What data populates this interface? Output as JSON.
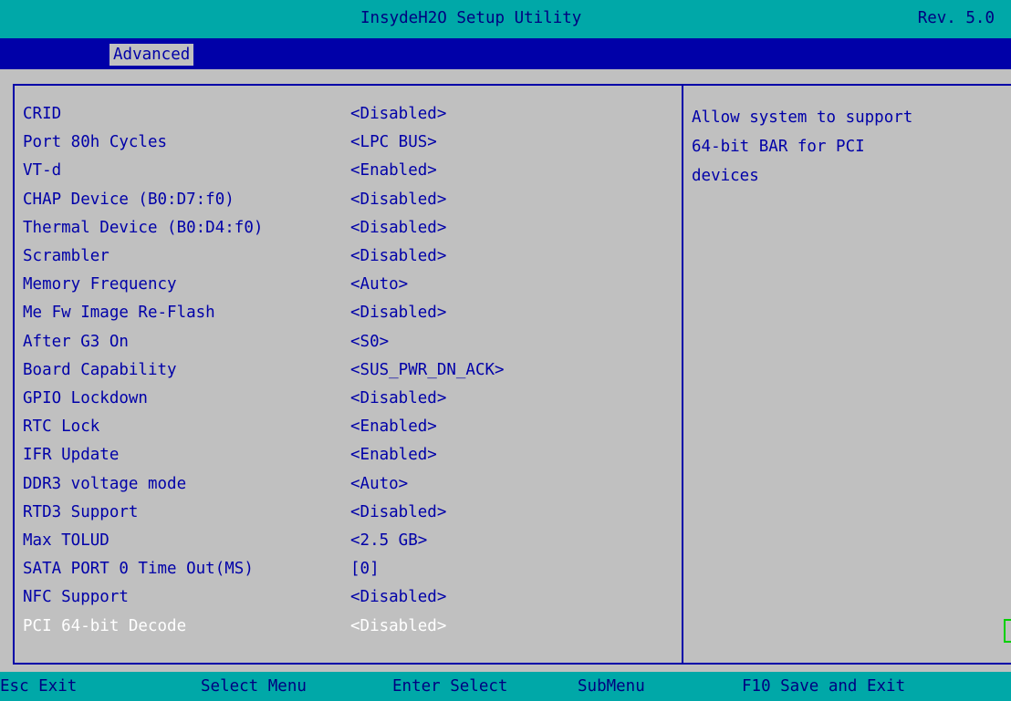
{
  "header": {
    "title": "InsydeH2O Setup Utility",
    "revision": "Rev. 5.0"
  },
  "menu": {
    "active_tab": "Advanced"
  },
  "settings": [
    {
      "label": "CRID",
      "value": "<Disabled>"
    },
    {
      "label": "Port 80h Cycles",
      "value": "<LPC BUS>"
    },
    {
      "label": "VT-d",
      "value": "<Enabled>"
    },
    {
      "label": "CHAP Device (B0:D7:f0)",
      "value": "<Disabled>"
    },
    {
      "label": "Thermal Device (B0:D4:f0)",
      "value": "<Disabled>"
    },
    {
      "label": "Scrambler",
      "value": "<Disabled>"
    },
    {
      "label": "Memory Frequency",
      "value": "<Auto>"
    },
    {
      "label": "Me Fw Image Re-Flash",
      "value": "<Disabled>"
    },
    {
      "label": "After G3 On",
      "value": "<S0>"
    },
    {
      "label": "Board Capability",
      "value": "<SUS_PWR_DN_ACK>"
    },
    {
      "label": "GPIO Lockdown",
      "value": "<Disabled>"
    },
    {
      "label": "RTC Lock",
      "value": "<Enabled>"
    },
    {
      "label": "IFR Update",
      "value": "<Enabled>"
    },
    {
      "label": "DDR3 voltage mode",
      "value": "<Auto>"
    },
    {
      "label": "RTD3 Support",
      "value": "<Disabled>"
    },
    {
      "label": "Max TOLUD",
      "value": "<2.5 GB>"
    },
    {
      "label": "SATA PORT 0 Time Out(MS)",
      "value": "[0]"
    },
    {
      "label": "NFC Support",
      "value": "<Disabled>"
    },
    {
      "label": "PCI 64-bit Decode",
      "value": "<Disabled>",
      "selected": true
    }
  ],
  "help": {
    "lines": [
      "Allow system to support",
      "64-bit BAR for PCI",
      "devices"
    ]
  },
  "footer": {
    "esc": "Esc Exit",
    "select_menu": "Select Menu",
    "enter": "Enter Select",
    "submenu": "SubMenu",
    "f10": "F10 Save and Exit"
  },
  "colors": {
    "background": "#c0c0c0",
    "text": "#0000a8",
    "bar": "#00a8a8",
    "menu_bar": "#0000a8",
    "selected_text": "#ffffff"
  }
}
